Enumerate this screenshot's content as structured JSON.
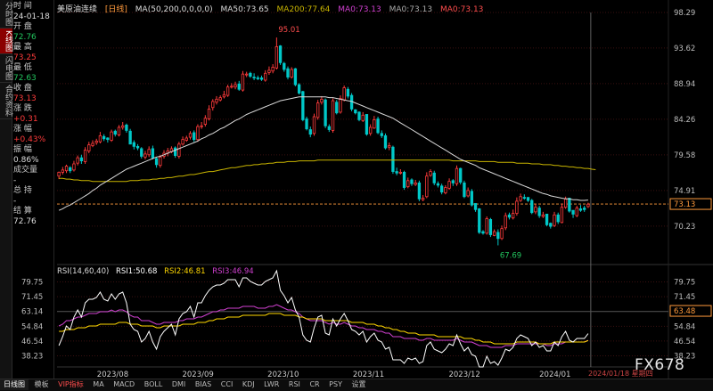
{
  "sidebar": {
    "tabs": [
      {
        "label": "分时图",
        "active": false
      },
      {
        "label": "K线图",
        "active": true
      },
      {
        "label": "闪电图",
        "active": false
      },
      {
        "label": "合约资料",
        "active": false
      }
    ]
  },
  "info": {
    "time_label": "时 间",
    "time_value": "24-01-18",
    "open_label": "开 盘",
    "open_value": "72.76",
    "high_label": "最 高",
    "high_value": "73.25",
    "low_label": "最 低",
    "low_value": "72.63",
    "close_label": "收 盘",
    "close_value": "73.13",
    "change_label": "涨 跌",
    "change_value": "+0.31",
    "pct_label": "涨 幅",
    "pct_value": "+0.43%",
    "amp_label": "振 幅",
    "amp_value": "0.86%",
    "vol_label": "成交量",
    "vol_value": "-",
    "hold_label": "总 持",
    "hold_value": "-",
    "settle_label": "结 算",
    "settle_value": "72.76"
  },
  "header": {
    "symbol": "美原油连续",
    "period": "[日线]",
    "ma": "MA(50,200,0,0,0,0)",
    "ma50": "MA50:73.65",
    "ma200": "MA200:77.64",
    "ma0a": "MA0:73.13",
    "ma0b": "MA0:73.13",
    "ma0c": "MA0:73.13"
  },
  "rsi": {
    "title": "RSI(14,60,40)",
    "rsi1": "RSI1:50.68",
    "rsi2": "RSI2:46.81",
    "rsi3": "RSI3:46.94"
  },
  "colors": {
    "up": "#ff3b3b",
    "down": "#00c8c8",
    "ma50": "#d9d9d9",
    "ma200": "#c8b400",
    "rsi1": "#ffffff",
    "rsi2": "#ffd700",
    "rsi3": "#d040d0",
    "grid": "#3a1010"
  },
  "chart_data": {
    "type": "candlestick",
    "price_axis_left": [
      "98.29",
      "93.62",
      "88.94",
      "84.26",
      "79.58",
      "74.91",
      "70.23"
    ],
    "price_axis_right": [
      "98.29",
      "93.62",
      "88.94",
      "84.26",
      "79.58",
      "74.91",
      "73.13",
      "70.23"
    ],
    "ylim": [
      66.0,
      98.29
    ],
    "annotations": [
      {
        "label": "95.01",
        "value": 95.01
      },
      {
        "label": "67.69",
        "value": 67.69
      }
    ],
    "current_price": 73.13,
    "x_labels": [
      "2023/08",
      "2023/09",
      "2023/10",
      "2023/11",
      "2023/12",
      "2024/01"
    ],
    "date_marker": "2024/01/18 星期四",
    "closes": [
      77.3,
      77.6,
      78.1,
      77.5,
      78.4,
      79.2,
      78.8,
      80.2,
      80.9,
      81.1,
      81.4,
      82.1,
      81.7,
      81.6,
      82.6,
      82.3,
      83.2,
      83.4,
      82.8,
      81.0,
      80.7,
      80.5,
      79.4,
      79.7,
      80.3,
      79.2,
      78.3,
      79.3,
      79.8,
      80.1,
      80.4,
      79.5,
      81.0,
      81.6,
      81.8,
      82.4,
      81.6,
      83.3,
      83.4,
      84.4,
      85.6,
      86.6,
      86.9,
      87.1,
      87.5,
      88.5,
      88.6,
      88.8,
      88.2,
      90.2,
      90.2,
      89.9,
      89.7,
      89.6,
      89.5,
      90.3,
      90.7,
      91.1,
      93.8,
      91.7,
      90.8,
      89.8,
      90.8,
      88.8,
      87.7,
      84.2,
      83.0,
      82.3,
      84.6,
      86.4,
      86.9,
      83.4,
      82.9,
      86.7,
      85.1,
      87.0,
      88.4,
      87.3,
      85.6,
      85.1,
      84.2,
      84.8,
      82.3,
      83.2,
      84.2,
      82.5,
      82.1,
      80.5,
      80.8,
      77.4,
      77.2,
      77.3,
      75.3,
      76.2,
      75.8,
      75.9,
      73.8,
      73.9,
      76.8,
      77.4,
      75.9,
      75.6,
      74.7,
      75.3,
      76.1,
      75.9,
      77.8,
      76.0,
      74.1,
      74.9,
      73.0,
      72.4,
      69.4,
      69.3,
      71.2,
      69.1,
      69.5,
      68.6,
      69.9,
      71.6,
      71.4,
      71.9,
      73.5,
      74.1,
      73.9,
      73.6,
      72.0,
      72.7,
      71.6,
      71.7,
      70.4,
      70.2,
      71.7,
      70.8,
      72.7,
      73.8,
      72.2,
      71.8,
      72.6,
      72.3,
      72.4,
      73.1
    ],
    "opens": [
      76.8,
      77.3,
      77.5,
      77.9,
      77.6,
      78.5,
      79.2,
      78.7,
      80.1,
      80.8,
      81.2,
      81.3,
      82.0,
      81.8,
      81.5,
      82.7,
      82.2,
      83.2,
      83.5,
      82.7,
      81.2,
      80.7,
      80.4,
      79.3,
      79.6,
      80.4,
      79.1,
      78.2,
      79.4,
      79.8,
      80.0,
      80.5,
      79.4,
      81.0,
      81.5,
      81.9,
      82.5,
      81.6,
      83.3,
      83.6,
      84.3,
      85.8,
      86.5,
      86.8,
      87.2,
      87.4,
      88.5,
      88.5,
      88.9,
      88.1,
      90.1,
      90.3,
      89.8,
      89.7,
      89.7,
      89.4,
      90.4,
      90.6,
      91.0,
      93.9,
      91.6,
      90.9,
      89.8,
      90.9,
      88.8,
      87.9,
      84.3,
      82.9,
      82.4,
      84.5,
      86.5,
      86.8,
      83.3,
      82.8,
      86.5,
      85.2,
      86.8,
      88.2,
      87.4,
      85.5,
      85.2,
      84.1,
      84.9,
      82.4,
      83.1,
      84.3,
      82.4,
      82.1,
      80.6,
      80.6,
      77.4,
      77.3,
      77.3,
      75.4,
      76.3,
      75.7,
      75.9,
      73.7,
      74.1,
      76.9,
      77.2,
      75.8,
      75.5,
      74.6,
      75.2,
      76.2,
      75.8,
      77.8,
      75.9,
      74.2,
      74.8,
      73.2,
      72.5,
      69.5,
      69.3,
      71.1,
      69.0,
      69.4,
      68.6,
      70.0,
      71.7,
      71.3,
      71.9,
      73.6,
      74.0,
      74.0,
      73.6,
      72.1,
      72.6,
      71.5,
      71.8,
      70.6,
      70.3,
      71.7,
      70.7,
      72.7,
      73.9,
      72.3,
      71.6,
      72.5,
      72.6,
      72.8
    ],
    "highs": [
      77.4,
      78.0,
      78.3,
      78.1,
      78.8,
      79.5,
      79.6,
      80.6,
      81.3,
      81.5,
      81.7,
      82.6,
      82.3,
      81.9,
      82.9,
      82.9,
      83.5,
      83.9,
      83.7,
      83.0,
      81.5,
      81.0,
      80.6,
      80.1,
      80.7,
      80.8,
      79.3,
      79.6,
      80.2,
      80.5,
      80.7,
      80.7,
      81.3,
      82.0,
      82.1,
      82.7,
      82.8,
      83.6,
      83.9,
      84.8,
      86.1,
      86.9,
      87.3,
      87.4,
      88.0,
      88.8,
      89.0,
      89.2,
      89.3,
      90.6,
      90.5,
      90.5,
      90.3,
      90.0,
      90.0,
      90.7,
      91.2,
      91.5,
      95.0,
      94.0,
      91.8,
      91.2,
      91.1,
      91.0,
      89.0,
      88.0,
      84.6,
      83.3,
      85.0,
      86.8,
      87.3,
      87.0,
      83.6,
      87.0,
      86.8,
      87.4,
      88.7,
      88.5,
      87.7,
      85.6,
      85.3,
      85.2,
      84.9,
      83.6,
      84.7,
      84.6,
      82.8,
      82.4,
      81.2,
      80.8,
      77.9,
      77.7,
      77.5,
      76.6,
      76.5,
      76.3,
      76.2,
      74.3,
      77.3,
      77.7,
      77.5,
      76.1,
      75.8,
      75.6,
      76.5,
      76.4,
      78.2,
      77.9,
      76.2,
      75.3,
      75.1,
      72.8,
      72.6,
      69.7,
      71.5,
      71.3,
      69.8,
      69.8,
      70.3,
      72.0,
      72.0,
      72.4,
      74.0,
      74.5,
      74.4,
      74.0,
      73.8,
      73.1,
      72.9,
      72.1,
      71.8,
      70.7,
      72.1,
      72.0,
      73.2,
      74.1,
      73.9,
      72.3,
      72.9,
      73.0,
      72.9,
      73.3
    ],
    "lows": [
      76.4,
      77.0,
      77.2,
      77.2,
      77.4,
      78.2,
      78.4,
      78.4,
      79.8,
      80.6,
      80.9,
      81.1,
      81.4,
      81.2,
      81.3,
      82.0,
      82.0,
      82.9,
      82.5,
      81.0,
      80.3,
      80.2,
      79.1,
      79.0,
      79.3,
      79.0,
      77.9,
      77.9,
      79.1,
      79.4,
      79.8,
      79.2,
      79.1,
      80.8,
      81.3,
      81.6,
      81.3,
      81.3,
      83.0,
      83.3,
      84.1,
      85.4,
      86.2,
      86.6,
      87.0,
      87.2,
      88.3,
      88.2,
      88.0,
      87.9,
      89.8,
      89.7,
      89.4,
      89.4,
      89.3,
      89.2,
      90.1,
      90.3,
      90.8,
      91.4,
      90.5,
      89.5,
      89.6,
      88.6,
      87.5,
      84.0,
      82.8,
      81.9,
      82.1,
      84.2,
      86.2,
      83.1,
      82.6,
      82.5,
      84.9,
      85.0,
      86.6,
      87.0,
      85.3,
      84.9,
      84.0,
      83.9,
      82.1,
      82.1,
      83.0,
      82.3,
      81.8,
      80.3,
      80.2,
      77.1,
      76.9,
      77.0,
      75.0,
      75.2,
      75.5,
      75.5,
      73.5,
      73.5,
      73.9,
      76.7,
      75.6,
      75.3,
      74.4,
      74.4,
      75.0,
      75.5,
      75.5,
      75.7,
      73.9,
      74.0,
      72.8,
      72.1,
      69.2,
      69.1,
      69.1,
      68.8,
      68.9,
      67.7,
      68.4,
      69.7,
      71.1,
      71.1,
      71.6,
      73.4,
      73.7,
      73.4,
      71.8,
      71.8,
      71.3,
      71.3,
      70.2,
      69.9,
      70.1,
      70.5,
      70.6,
      72.5,
      72.0,
      71.3,
      71.4,
      72.1,
      72.1,
      72.6
    ],
    "ma50": [
      72.3,
      72.5,
      72.8,
      73.0,
      73.3,
      73.6,
      73.9,
      74.2,
      74.5,
      74.9,
      75.2,
      75.6,
      75.9,
      76.2,
      76.5,
      76.8,
      77.1,
      77.4,
      77.7,
      77.9,
      78.1,
      78.3,
      78.5,
      78.7,
      78.9,
      79.1,
      79.3,
      79.4,
      79.6,
      79.8,
      80.0,
      80.2,
      80.4,
      80.6,
      80.8,
      81.0,
      81.2,
      81.4,
      81.7,
      81.9,
      82.2,
      82.4,
      82.7,
      83.0,
      83.2,
      83.5,
      83.8,
      84.1,
      84.3,
      84.6,
      84.9,
      85.1,
      85.3,
      85.5,
      85.7,
      85.9,
      86.1,
      86.3,
      86.5,
      86.7,
      86.8,
      86.9,
      87.0,
      87.1,
      87.2,
      87.2,
      87.2,
      87.2,
      87.2,
      87.2,
      87.2,
      87.2,
      87.1,
      87.1,
      87.0,
      86.9,
      86.8,
      86.7,
      86.6,
      86.4,
      86.2,
      86.0,
      85.8,
      85.6,
      85.4,
      85.2,
      85.0,
      84.8,
      84.6,
      84.4,
      84.1,
      83.8,
      83.5,
      83.2,
      82.9,
      82.6,
      82.3,
      82.0,
      81.7,
      81.4,
      81.1,
      80.8,
      80.5,
      80.2,
      79.9,
      79.6,
      79.3,
      79.0,
      78.8,
      78.6,
      78.4,
      78.2,
      77.9,
      77.7,
      77.5,
      77.3,
      77.1,
      76.9,
      76.7,
      76.5,
      76.3,
      76.1,
      75.9,
      75.7,
      75.5,
      75.3,
      75.1,
      74.9,
      74.7,
      74.5,
      74.4,
      74.2,
      74.1,
      74.0,
      73.9,
      73.8,
      73.8,
      73.7,
      73.7,
      73.6,
      73.6,
      73.65
    ],
    "ma200": [
      76.5,
      76.5,
      76.4,
      76.4,
      76.3,
      76.3,
      76.2,
      76.2,
      76.2,
      76.1,
      76.1,
      76.1,
      76.1,
      76.1,
      76.1,
      76.1,
      76.1,
      76.1,
      76.1,
      76.2,
      76.2,
      76.2,
      76.3,
      76.3,
      76.3,
      76.4,
      76.4,
      76.5,
      76.5,
      76.6,
      76.6,
      76.7,
      76.8,
      76.8,
      76.9,
      77.0,
      77.0,
      77.1,
      77.2,
      77.3,
      77.4,
      77.4,
      77.5,
      77.6,
      77.7,
      77.8,
      77.9,
      77.9,
      78.0,
      78.1,
      78.2,
      78.2,
      78.3,
      78.3,
      78.4,
      78.4,
      78.5,
      78.5,
      78.6,
      78.6,
      78.6,
      78.7,
      78.7,
      78.7,
      78.8,
      78.8,
      78.8,
      78.8,
      78.8,
      78.9,
      78.9,
      78.9,
      78.9,
      78.9,
      78.9,
      78.9,
      78.9,
      78.9,
      78.9,
      78.9,
      78.9,
      78.9,
      78.9,
      78.9,
      78.9,
      78.9,
      78.9,
      78.9,
      78.9,
      78.9,
      78.9,
      78.9,
      78.9,
      78.9,
      78.9,
      78.9,
      78.9,
      78.9,
      78.9,
      78.9,
      78.9,
      78.9,
      78.9,
      78.9,
      78.9,
      78.8,
      78.8,
      78.8,
      78.8,
      78.8,
      78.8,
      78.8,
      78.7,
      78.7,
      78.7,
      78.7,
      78.7,
      78.6,
      78.6,
      78.6,
      78.6,
      78.6,
      78.5,
      78.5,
      78.5,
      78.5,
      78.4,
      78.4,
      78.4,
      78.3,
      78.3,
      78.3,
      78.2,
      78.2,
      78.1,
      78.1,
      78.0,
      78.0,
      77.9,
      77.9,
      77.8,
      77.8,
      77.7,
      77.64
    ],
    "rsi_axis": [
      "79.75",
      "71.45",
      "63.14",
      "54.84",
      "46.54",
      "38.23"
    ],
    "rsi_axis_right": [
      "79.75",
      "71.45",
      "63.48",
      "54.84",
      "46.54",
      "38.23"
    ],
    "rsi_ylim": [
      34.0,
      82.0
    ],
    "rsi1": [
      44,
      49,
      55,
      53,
      60,
      64,
      60,
      68,
      70,
      70,
      71,
      74,
      70,
      69,
      73,
      70,
      73,
      74,
      68,
      56,
      53,
      52,
      46,
      48,
      52,
      46,
      42,
      49,
      52,
      54,
      56,
      50,
      59,
      62,
      63,
      66,
      60,
      68,
      68,
      72,
      75,
      77,
      78,
      78,
      79,
      81,
      81,
      81,
      77,
      82,
      82,
      80,
      79,
      78,
      78,
      80,
      81,
      82,
      86,
      75,
      72,
      68,
      71,
      64,
      60,
      50,
      47,
      46,
      54,
      60,
      61,
      51,
      50,
      59,
      55,
      59,
      62,
      58,
      53,
      52,
      50,
      52,
      46,
      49,
      51,
      47,
      46,
      42,
      43,
      36,
      36,
      36,
      34,
      37,
      36,
      37,
      34,
      35,
      44,
      46,
      42,
      41,
      40,
      42,
      45,
      44,
      50,
      45,
      41,
      43,
      39,
      38,
      32,
      32,
      38,
      34,
      35,
      33,
      37,
      42,
      41,
      43,
      48,
      50,
      49,
      48,
      44,
      46,
      43,
      44,
      41,
      41,
      46,
      44,
      49,
      52,
      47,
      46,
      48,
      48,
      48,
      50.68
    ],
    "rsi2": [
      52,
      52,
      53,
      53,
      53,
      54,
      54,
      54,
      55,
      55,
      55,
      56,
      56,
      56,
      56,
      56,
      57,
      57,
      57,
      56,
      56,
      56,
      55,
      55,
      55,
      55,
      54,
      54,
      55,
      55,
      55,
      55,
      55,
      56,
      56,
      56,
      56,
      57,
      57,
      57,
      58,
      58,
      59,
      59,
      59,
      60,
      60,
      60,
      60,
      61,
      61,
      61,
      61,
      61,
      61,
      61,
      62,
      62,
      62,
      62,
      61,
      61,
      61,
      61,
      60,
      60,
      59,
      59,
      59,
      59,
      59,
      58,
      58,
      58,
      58,
      58,
      58,
      58,
      57,
      57,
      57,
      57,
      56,
      56,
      56,
      55,
      55,
      54,
      54,
      53,
      53,
      52,
      52,
      51,
      51,
      51,
      50,
      50,
      50,
      50,
      50,
      49,
      49,
      49,
      49,
      49,
      49,
      49,
      48,
      48,
      48,
      47,
      47,
      46,
      46,
      46,
      45,
      45,
      45,
      45,
      45,
      45,
      46,
      46,
      46,
      46,
      46,
      46,
      45,
      45,
      45,
      45,
      46,
      46,
      46,
      46,
      46,
      46,
      46,
      46,
      46,
      46.81
    ],
    "rsi3": [
      55,
      56,
      58,
      58,
      59,
      60,
      60,
      61,
      62,
      62,
      62,
      63,
      63,
      63,
      64,
      63,
      64,
      64,
      63,
      61,
      60,
      60,
      58,
      58,
      58,
      57,
      56,
      56,
      57,
      57,
      57,
      57,
      58,
      58,
      59,
      59,
      59,
      60,
      60,
      61,
      62,
      63,
      63,
      64,
      64,
      65,
      65,
      65,
      65,
      66,
      66,
      66,
      66,
      65,
      65,
      65,
      66,
      66,
      67,
      66,
      65,
      64,
      64,
      63,
      62,
      60,
      59,
      58,
      58,
      58,
      58,
      57,
      56,
      57,
      56,
      56,
      57,
      56,
      55,
      55,
      54,
      54,
      53,
      53,
      53,
      52,
      52,
      51,
      51,
      49,
      49,
      49,
      48,
      48,
      48,
      48,
      47,
      47,
      48,
      48,
      47,
      47,
      47,
      47,
      47,
      47,
      48,
      47,
      46,
      46,
      46,
      45,
      44,
      44,
      44,
      43,
      43,
      43,
      43,
      44,
      44,
      44,
      45,
      45,
      45,
      45,
      45,
      45,
      45,
      45,
      44,
      44,
      45,
      45,
      45,
      46,
      46,
      46,
      46,
      46,
      46,
      46.94
    ]
  },
  "bottom_toolbar": {
    "items": [
      "日线图",
      "模板",
      "VIP指标",
      "MA",
      "MACD",
      "BOLL",
      "DMI",
      "BIAS",
      "CCI",
      "KDJ",
      "LWR",
      "RSI",
      "CR",
      "PSY",
      "设置"
    ]
  },
  "watermark": "FX678"
}
